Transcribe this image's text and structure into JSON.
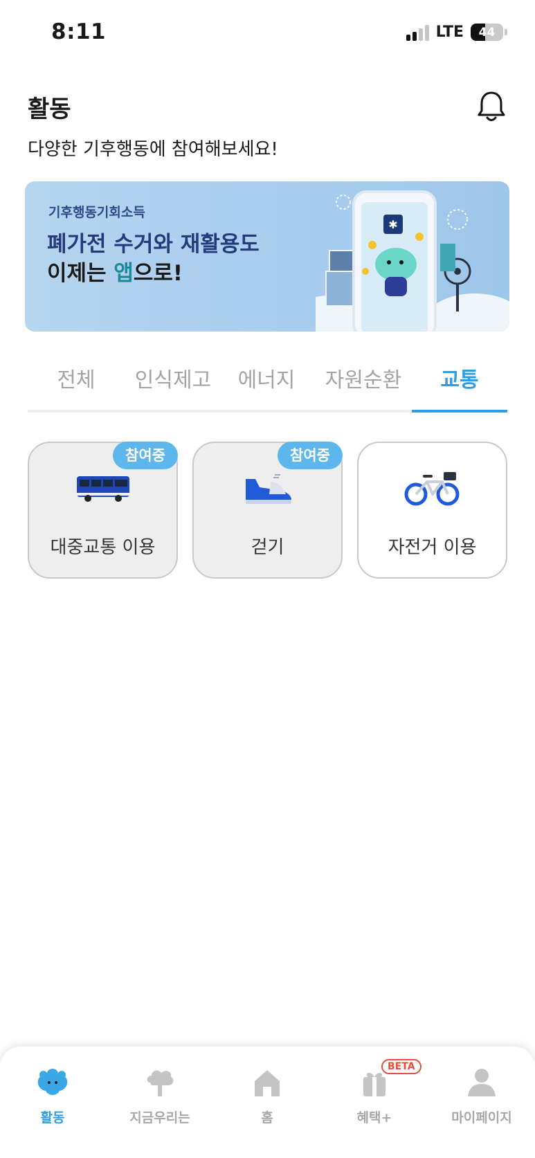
{
  "status_bar": {
    "time": "8:11",
    "network": "LTE",
    "battery": "44"
  },
  "header": {
    "title": "활동",
    "subtitle": "다양한 기후행동에 참여해보세요!"
  },
  "banner": {
    "small_text": "기후행동기회소득",
    "line1": "폐가전 수거와 재활용도",
    "line2_prefix": "이제는 ",
    "line2_highlight": "앱",
    "line2_suffix": "으로!"
  },
  "tabs": [
    {
      "label": "전체",
      "active": false
    },
    {
      "label": "인식제고",
      "active": false
    },
    {
      "label": "에너지",
      "active": false
    },
    {
      "label": "자원순환",
      "active": false
    },
    {
      "label": "교통",
      "active": true
    }
  ],
  "cards": [
    {
      "label": "대중교통 이용",
      "badge": "참여중",
      "icon": "bus-icon"
    },
    {
      "label": "걷기",
      "badge": "참여중",
      "icon": "shoe-icon"
    },
    {
      "label": "자전거 이용",
      "badge": "",
      "icon": "bicycle-icon"
    }
  ],
  "bottom_nav": [
    {
      "label": "활동",
      "icon": "mascot-icon",
      "active": true
    },
    {
      "label": "지금우리는",
      "icon": "tree-icon",
      "active": false
    },
    {
      "label": "홈",
      "icon": "home-icon",
      "active": false
    },
    {
      "label": "혜택+",
      "icon": "gift-icon",
      "active": false,
      "badge": "BETA"
    },
    {
      "label": "마이페이지",
      "icon": "person-icon",
      "active": false
    }
  ],
  "colors": {
    "accent": "#2f9de0",
    "badge": "#5db7ec",
    "beta": "#e74c3c"
  }
}
